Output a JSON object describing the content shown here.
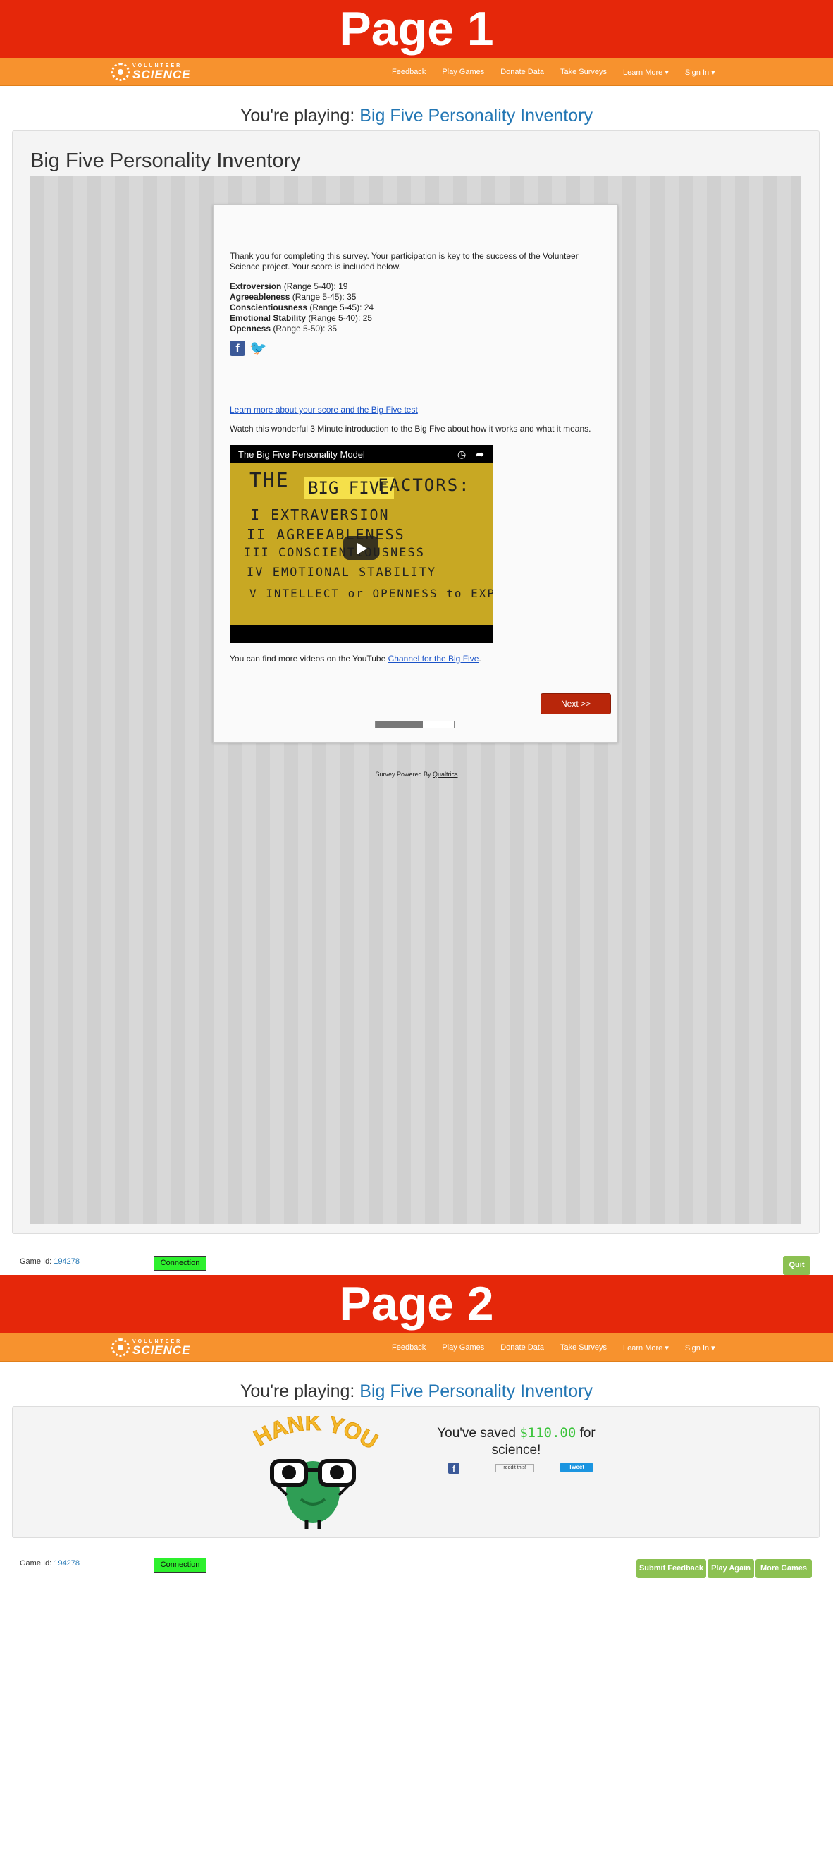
{
  "page1": {
    "banner": "Page 1"
  },
  "page2": {
    "banner": "Page 2"
  },
  "navbar": {
    "logo_small": "VOLUNTEER",
    "logo_big": "SCIENCE",
    "items": [
      "Feedback",
      "Play Games",
      "Donate Data",
      "Take Surveys",
      "Learn More ▾",
      "Sign In ▾"
    ]
  },
  "playing": {
    "prefix": "You're playing: ",
    "game_name": "Big Five Personality Inventory"
  },
  "panel_title": "Big Five Personality Inventory",
  "survey": {
    "thanks": "Thank you for completing this survey. Your participation is key to the success of the Volunteer Science project.  Your score is included below.",
    "scores": [
      {
        "name": "Extroversion",
        "range": " (Range 5-40):  19"
      },
      {
        "name": "Agreeableness",
        "range": " (Range 5-45):  35"
      },
      {
        "name": "Conscientiousness",
        "range": " (Range 5-45):  24"
      },
      {
        "name": "Emotional Stability",
        "range": " (Range 5-40):  25"
      },
      {
        "name": "Openness",
        "range": " (Range 5-50): 35"
      }
    ],
    "learn_link": "Learn more about your score and the Big Five test",
    "watch_text": "Watch this wonderful 3 Minute introduction to the Big Five about how it works and what it means.",
    "video": {
      "title": "The Big Five Personality Model",
      "the": "THE",
      "big_five": "BIG FIVE",
      "factors_word": "FACTORS:",
      "factors": [
        "I  EXTRAVERSION",
        "II  AGREEABLENESS",
        "III CONSCIENTIOUSNESS",
        "IV  EMOTIONAL STABILITY",
        "V  INTELLECT or OPENNESS to EXP"
      ]
    },
    "more_prefix": "You can find more videos on the YouTube ",
    "more_link": "Channel for the Big Five",
    "more_suffix": ".",
    "next": "Next >>",
    "progress": 0.6
  },
  "powered": {
    "prefix": "Survey Powered By ",
    "link": "Qualtrics"
  },
  "footer": {
    "game_id_label": "Game Id: ",
    "game_id": "194278",
    "connection": "Connection",
    "quit": "Quit",
    "submit_feedback": "Submit Feedback",
    "play_again": "Play Again",
    "more_games": "More Games"
  },
  "thanks_page": {
    "thank_you": "THANK YOU!",
    "saved_prefix": "You've saved ",
    "saved_amount": "$110.00",
    "saved_suffix": " for science!",
    "reddit": "reddit this!",
    "tweet": "Tweet"
  },
  "colors": {
    "banner": "#e5270a",
    "navbar": "#f7922e",
    "link": "#2276b4",
    "next": "#b8260a",
    "green": "#8cc152",
    "connection": "#2df02d"
  },
  "icons": [
    "gear-logo-icon",
    "facebook-icon",
    "twitter-icon",
    "play-icon",
    "clock-icon",
    "share-icon"
  ]
}
